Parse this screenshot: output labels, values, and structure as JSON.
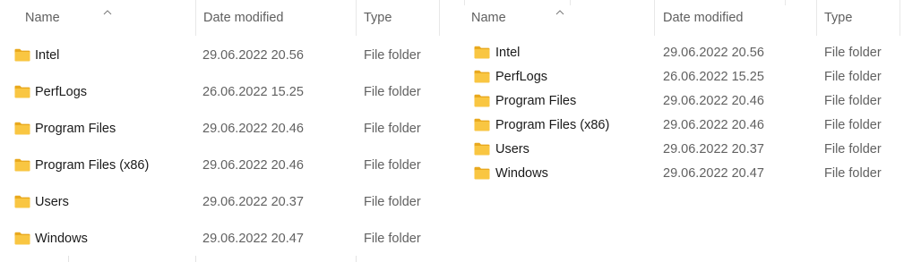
{
  "left_view": {
    "columns": {
      "name": "Name",
      "date_modified": "Date modified",
      "type": "Type"
    },
    "rows": [
      {
        "name": "Intel",
        "date": "29.06.2022 20.56",
        "type": "File folder"
      },
      {
        "name": "PerfLogs",
        "date": "26.06.2022 15.25",
        "type": "File folder"
      },
      {
        "name": "Program Files",
        "date": "29.06.2022 20.46",
        "type": "File folder"
      },
      {
        "name": "Program Files (x86)",
        "date": "29.06.2022 20.46",
        "type": "File folder"
      },
      {
        "name": "Users",
        "date": "29.06.2022 20.37",
        "type": "File folder"
      },
      {
        "name": "Windows",
        "date": "29.06.2022 20.47",
        "type": "File folder"
      }
    ]
  },
  "right_view": {
    "columns": {
      "name": "Name",
      "date_modified": "Date modified",
      "type": "Type"
    },
    "rows": [
      {
        "name": "Intel",
        "date": "29.06.2022 20.56",
        "type": "File folder"
      },
      {
        "name": "PerfLogs",
        "date": "26.06.2022 15.25",
        "type": "File folder"
      },
      {
        "name": "Program Files",
        "date": "29.06.2022 20.46",
        "type": "File folder"
      },
      {
        "name": "Program Files (x86)",
        "date": "29.06.2022 20.46",
        "type": "File folder"
      },
      {
        "name": "Users",
        "date": "29.06.2022 20.37",
        "type": "File folder"
      },
      {
        "name": "Windows",
        "date": "29.06.2022 20.47",
        "type": "File folder"
      }
    ]
  },
  "icons": {
    "folder": "folder-icon",
    "sort": "sort-ascending-icon"
  },
  "colors": {
    "folder_body": "#F9C642",
    "folder_tab": "#E9A91E",
    "header_text": "#5f5f5f",
    "secondary_text": "#616161"
  }
}
